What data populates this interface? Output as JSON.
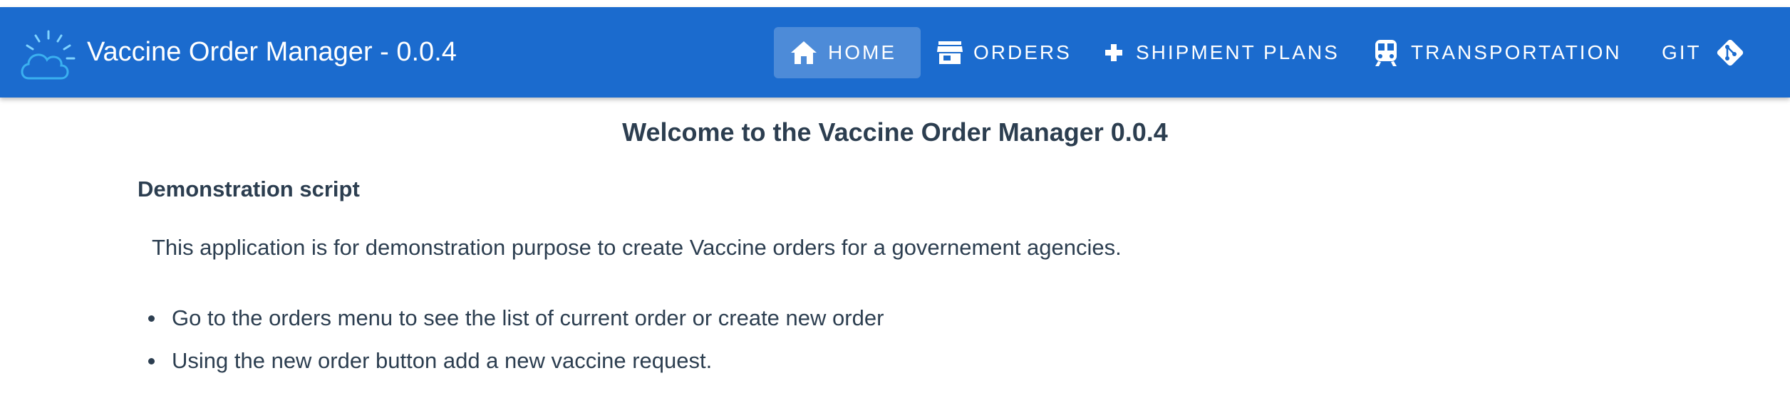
{
  "app": {
    "title": "Vaccine Order Manager - 0.0.4",
    "brand_color": "#1b6bce",
    "logo_icon": "cloud-sun-logo"
  },
  "nav": {
    "items": [
      {
        "id": "home",
        "label": "HOME",
        "icon": "home-icon",
        "active": true
      },
      {
        "id": "orders",
        "label": "ORDERS",
        "icon": "store-icon",
        "active": false
      },
      {
        "id": "shipment",
        "label": "SHIPMENT PLANS",
        "icon": "plus-icon",
        "active": false
      },
      {
        "id": "transport",
        "label": "TRANSPORTATION",
        "icon": "train-icon",
        "active": false
      },
      {
        "id": "git",
        "label": "GIT",
        "icon": "git-icon",
        "active": false
      }
    ]
  },
  "main": {
    "title": "Welcome to the Vaccine Order Manager 0.0.4",
    "section_heading": "Demonstration script",
    "intro": "This application is for demonstration purpose to create Vaccine orders for a governement agencies.",
    "bullets": [
      "Go to the orders menu to see the list of current order or create new order",
      "Using the new order button add a new vaccine request."
    ]
  }
}
